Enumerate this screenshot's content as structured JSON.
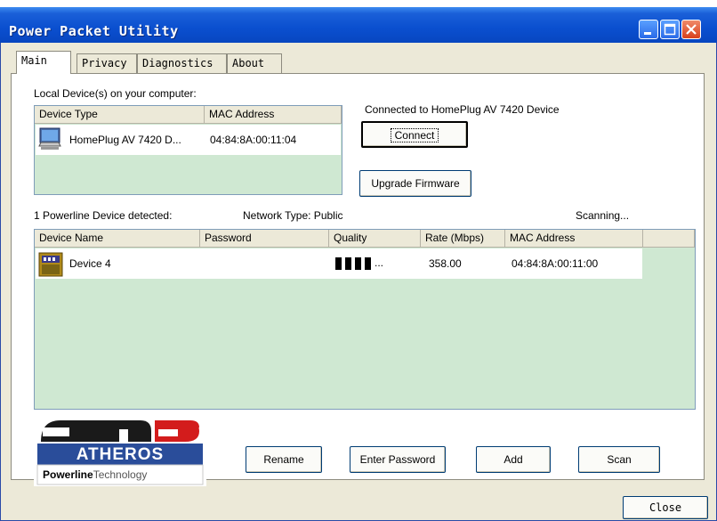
{
  "window": {
    "title": "Power Packet Utility"
  },
  "tabs": [
    {
      "label": "Main"
    },
    {
      "label": "Privacy"
    },
    {
      "label": "Diagnostics"
    },
    {
      "label": "About"
    }
  ],
  "local": {
    "heading": "Local Device(s) on your computer:",
    "columns": [
      "Device Type",
      "MAC Address"
    ],
    "rows": [
      {
        "type": "HomePlug AV 7420 D...",
        "mac": "04:84:8A:00:11:04"
      }
    ],
    "status": "Connected to HomePlug AV 7420 Device",
    "connect_label": "Connect",
    "upgrade_label": "Upgrade Firmware"
  },
  "powerline": {
    "detected": "1 Powerline Device detected:",
    "network_type": "Network Type: Public",
    "scanning": "Scanning...",
    "columns": [
      "Device Name",
      "Password",
      "Quality",
      "Rate (Mbps)",
      "MAC Address"
    ],
    "rows": [
      {
        "name": "Device 4",
        "password": "",
        "quality_bars": 4,
        "quality_suffix": "...",
        "rate": "358.00",
        "mac": "04:84:8A:00:11:00"
      }
    ]
  },
  "logo": {
    "brand": "ATHEROS",
    "tagline_bold": "Powerline",
    "tagline": "Technology"
  },
  "actions": {
    "rename": "Rename",
    "enter_password": "Enter Password",
    "add": "Add",
    "scan": "Scan"
  },
  "footer": {
    "close": "Close"
  }
}
